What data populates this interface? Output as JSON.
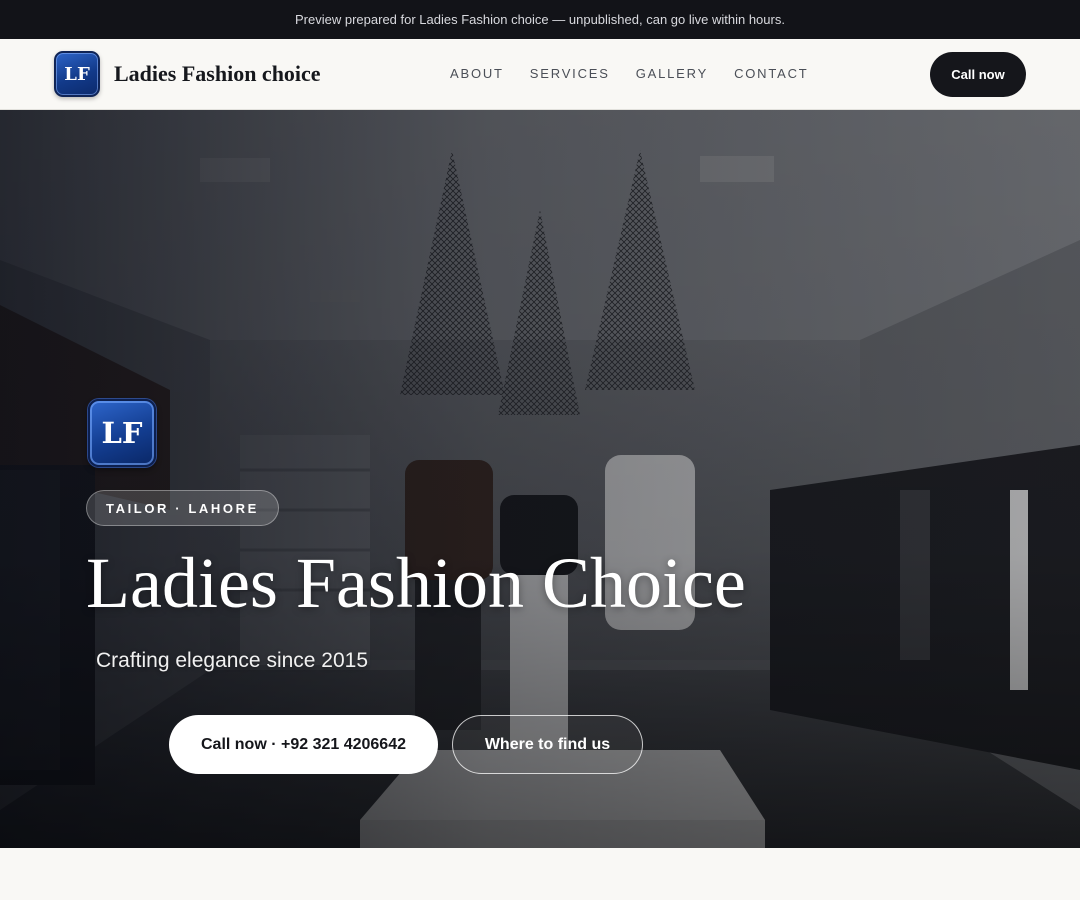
{
  "preview_banner": "Preview prepared for Ladies Fashion choice — unpublished, can go live within hours.",
  "header": {
    "logo_initials": "LF",
    "brand_name": "Ladies Fashion choice",
    "nav": [
      "About",
      "Services",
      "Gallery",
      "Contact"
    ],
    "cta_label": "Call now"
  },
  "hero": {
    "logo_initials": "LF",
    "eyebrow": "TAILOR · LAHORE",
    "title": "Ladies Fashion Choice",
    "subtitle": "Crafting elegance since 2015",
    "primary_button": "Call now · +92 321 4206642",
    "secondary_button": "Where to find us"
  },
  "colors": {
    "dark": "#15161b",
    "page_background": "#f9f8f5",
    "logo_blue": "#133d90"
  }
}
